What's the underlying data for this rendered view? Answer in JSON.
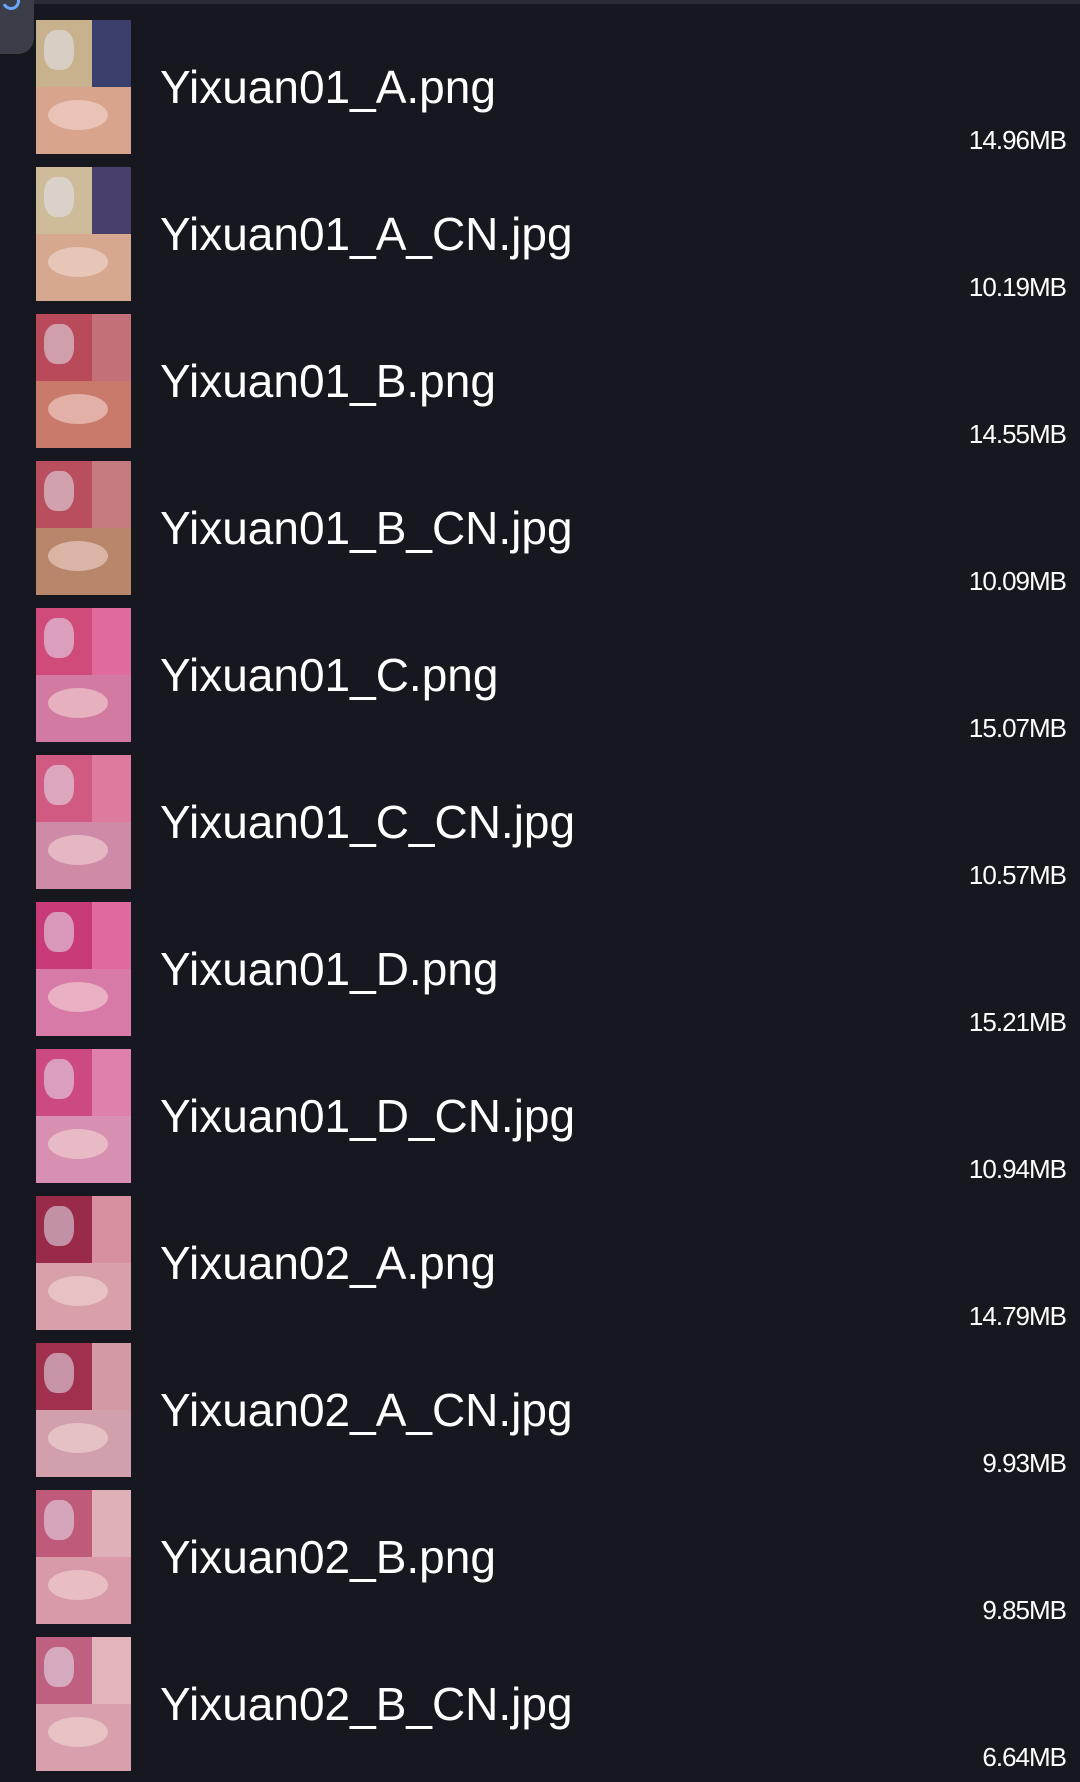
{
  "files": [
    {
      "name": "Yixuan01_A.png",
      "size": "14.96MB",
      "thumb_icon": "image-thumbnail-icon",
      "colors": [
        "#c8b28e",
        "#3a3f6e",
        "#d8a48e"
      ]
    },
    {
      "name": "Yixuan01_A_CN.jpg",
      "size": "10.19MB",
      "thumb_icon": "image-thumbnail-icon",
      "colors": [
        "#cdbb9a",
        "#4a3f6a",
        "#d6a890"
      ]
    },
    {
      "name": "Yixuan01_B.png",
      "size": "14.55MB",
      "thumb_icon": "image-thumbnail-icon",
      "colors": [
        "#b94a5a",
        "#c4707a",
        "#c97a6a"
      ]
    },
    {
      "name": "Yixuan01_B_CN.jpg",
      "size": "10.09MB",
      "thumb_icon": "image-thumbnail-icon",
      "colors": [
        "#b84e5e",
        "#c47a7e",
        "#b8866a"
      ]
    },
    {
      "name": "Yixuan01_C.png",
      "size": "15.07MB",
      "thumb_icon": "image-thumbnail-icon",
      "colors": [
        "#d04a7a",
        "#e06a9a",
        "#d27aa0"
      ]
    },
    {
      "name": "Yixuan01_C_CN.jpg",
      "size": "10.57MB",
      "thumb_icon": "image-thumbnail-icon",
      "colors": [
        "#d05a82",
        "#de7aa0",
        "#cf8aa8"
      ]
    },
    {
      "name": "Yixuan01_D.png",
      "size": "15.21MB",
      "thumb_icon": "image-thumbnail-icon",
      "colors": [
        "#c93a78",
        "#e06aa0",
        "#d87aa8"
      ]
    },
    {
      "name": "Yixuan01_D_CN.jpg",
      "size": "10.94MB",
      "thumb_icon": "image-thumbnail-icon",
      "colors": [
        "#cc4a80",
        "#de80a8",
        "#d890b0"
      ]
    },
    {
      "name": "Yixuan02_A.png",
      "size": "14.79MB",
      "thumb_icon": "image-thumbnail-icon",
      "colors": [
        "#9a2a4a",
        "#d890a0",
        "#d8a0a8"
      ]
    },
    {
      "name": "Yixuan02_A_CN.jpg",
      "size": "9.93MB",
      "thumb_icon": "image-thumbnail-icon",
      "colors": [
        "#a0304e",
        "#d49aa4",
        "#d2a0ac"
      ]
    },
    {
      "name": "Yixuan02_B.png",
      "size": "9.85MB",
      "thumb_icon": "image-thumbnail-icon",
      "colors": [
        "#c05a7a",
        "#e0b0b8",
        "#d89aa8"
      ]
    },
    {
      "name": "Yixuan02_B_CN.jpg",
      "size": "6.64MB",
      "thumb_icon": "image-thumbnail-icon",
      "colors": [
        "#c06080",
        "#e2b4bc",
        "#d8a0ac"
      ]
    }
  ]
}
